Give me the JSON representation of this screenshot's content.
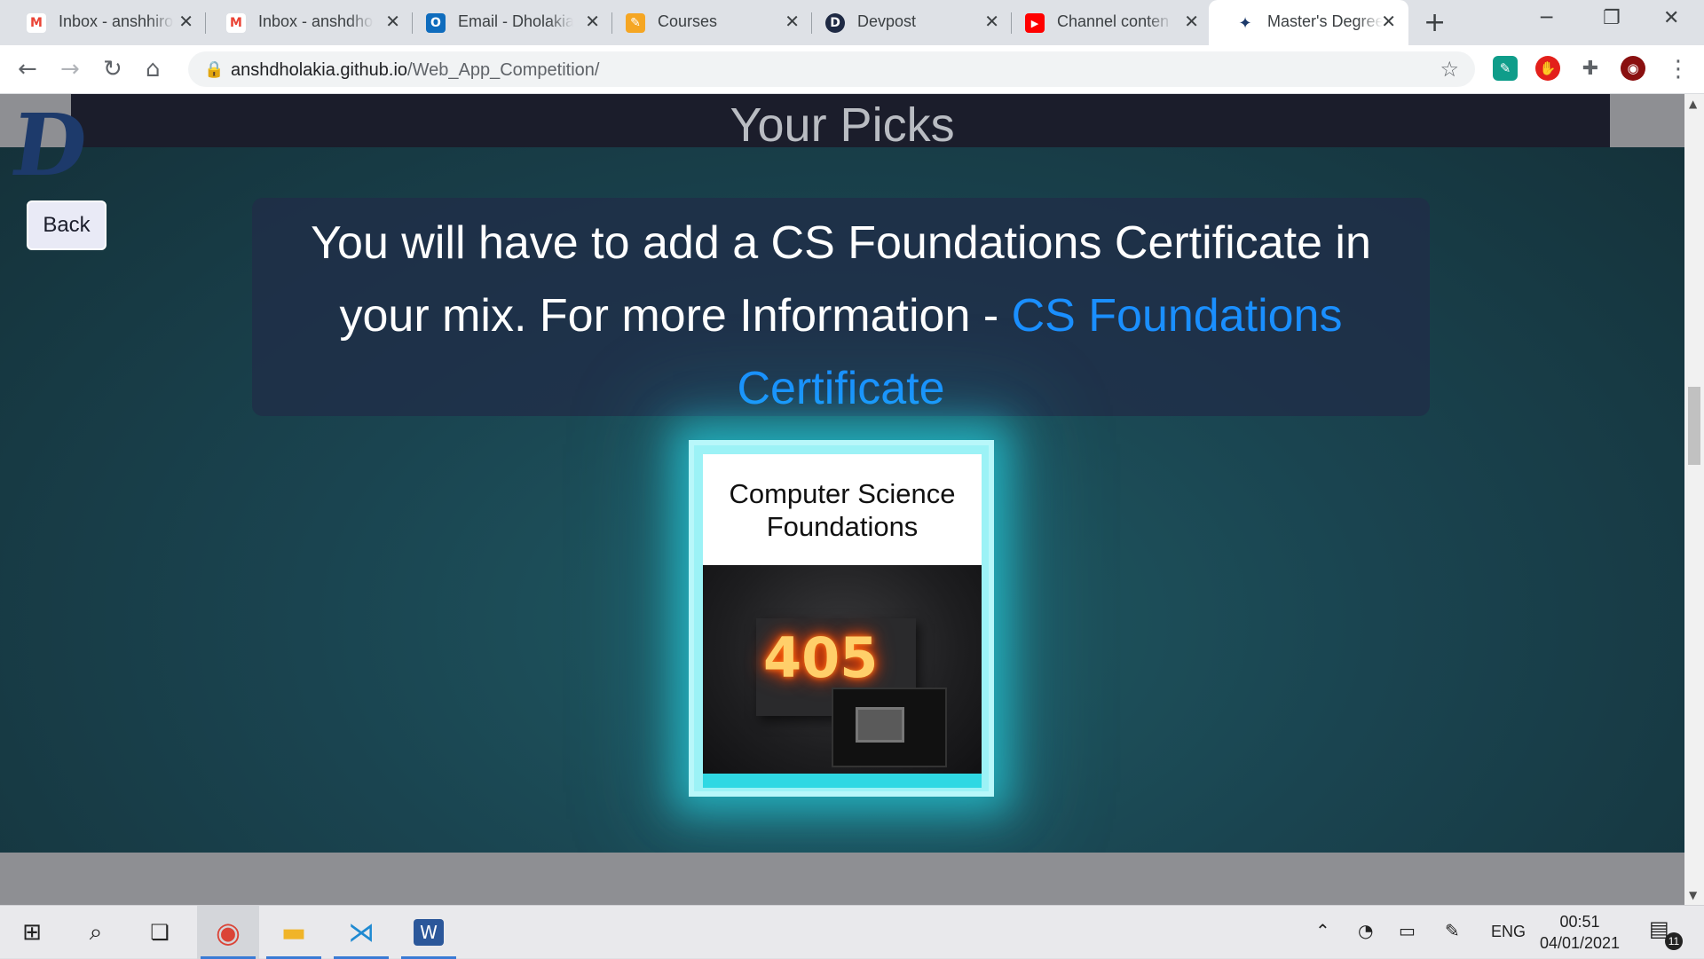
{
  "browser": {
    "tabs": [
      {
        "label": "Inbox - anshhiro",
        "icon": "gmail-icon",
        "color": "#ea4335",
        "glyph": "M"
      },
      {
        "label": "Inbox - anshdho",
        "icon": "gmail-icon",
        "color": "#ea4335",
        "glyph": "M"
      },
      {
        "label": "Email - Dholakia",
        "icon": "outlook-icon",
        "color": "#0f6cbd",
        "glyph": "O"
      },
      {
        "label": "Courses",
        "icon": "pencil-icon",
        "color": "#f5a623",
        "glyph": "✎"
      },
      {
        "label": "Devpost",
        "icon": "devpost-icon",
        "color": "#1f2a44",
        "glyph": "D"
      },
      {
        "label": "Channel conten",
        "icon": "youtube-icon",
        "color": "#ff0000",
        "glyph": "▶"
      },
      {
        "label": "Master's Degree",
        "icon": "eagle-icon",
        "color": "#1d3a6b",
        "glyph": "✦"
      }
    ],
    "url_host": "anshdholakia.github.io",
    "url_path": "/Web_App_Competition/"
  },
  "page": {
    "title": "Your Picks",
    "back_label": "Back",
    "notice_text": "You will have to add a CS Foundations Certificate in your mix. For more Information - ",
    "notice_link": "CS Foundations Certificate",
    "card_title": "Computer Science Foundations",
    "card_image_number": "405"
  },
  "taskbar": {
    "language": "ENG",
    "time": "00:51",
    "date": "04/01/2021",
    "notification_count": "11"
  },
  "colors": {
    "accent_link": "#1a8fff",
    "card_glow": "#28e2f0"
  }
}
